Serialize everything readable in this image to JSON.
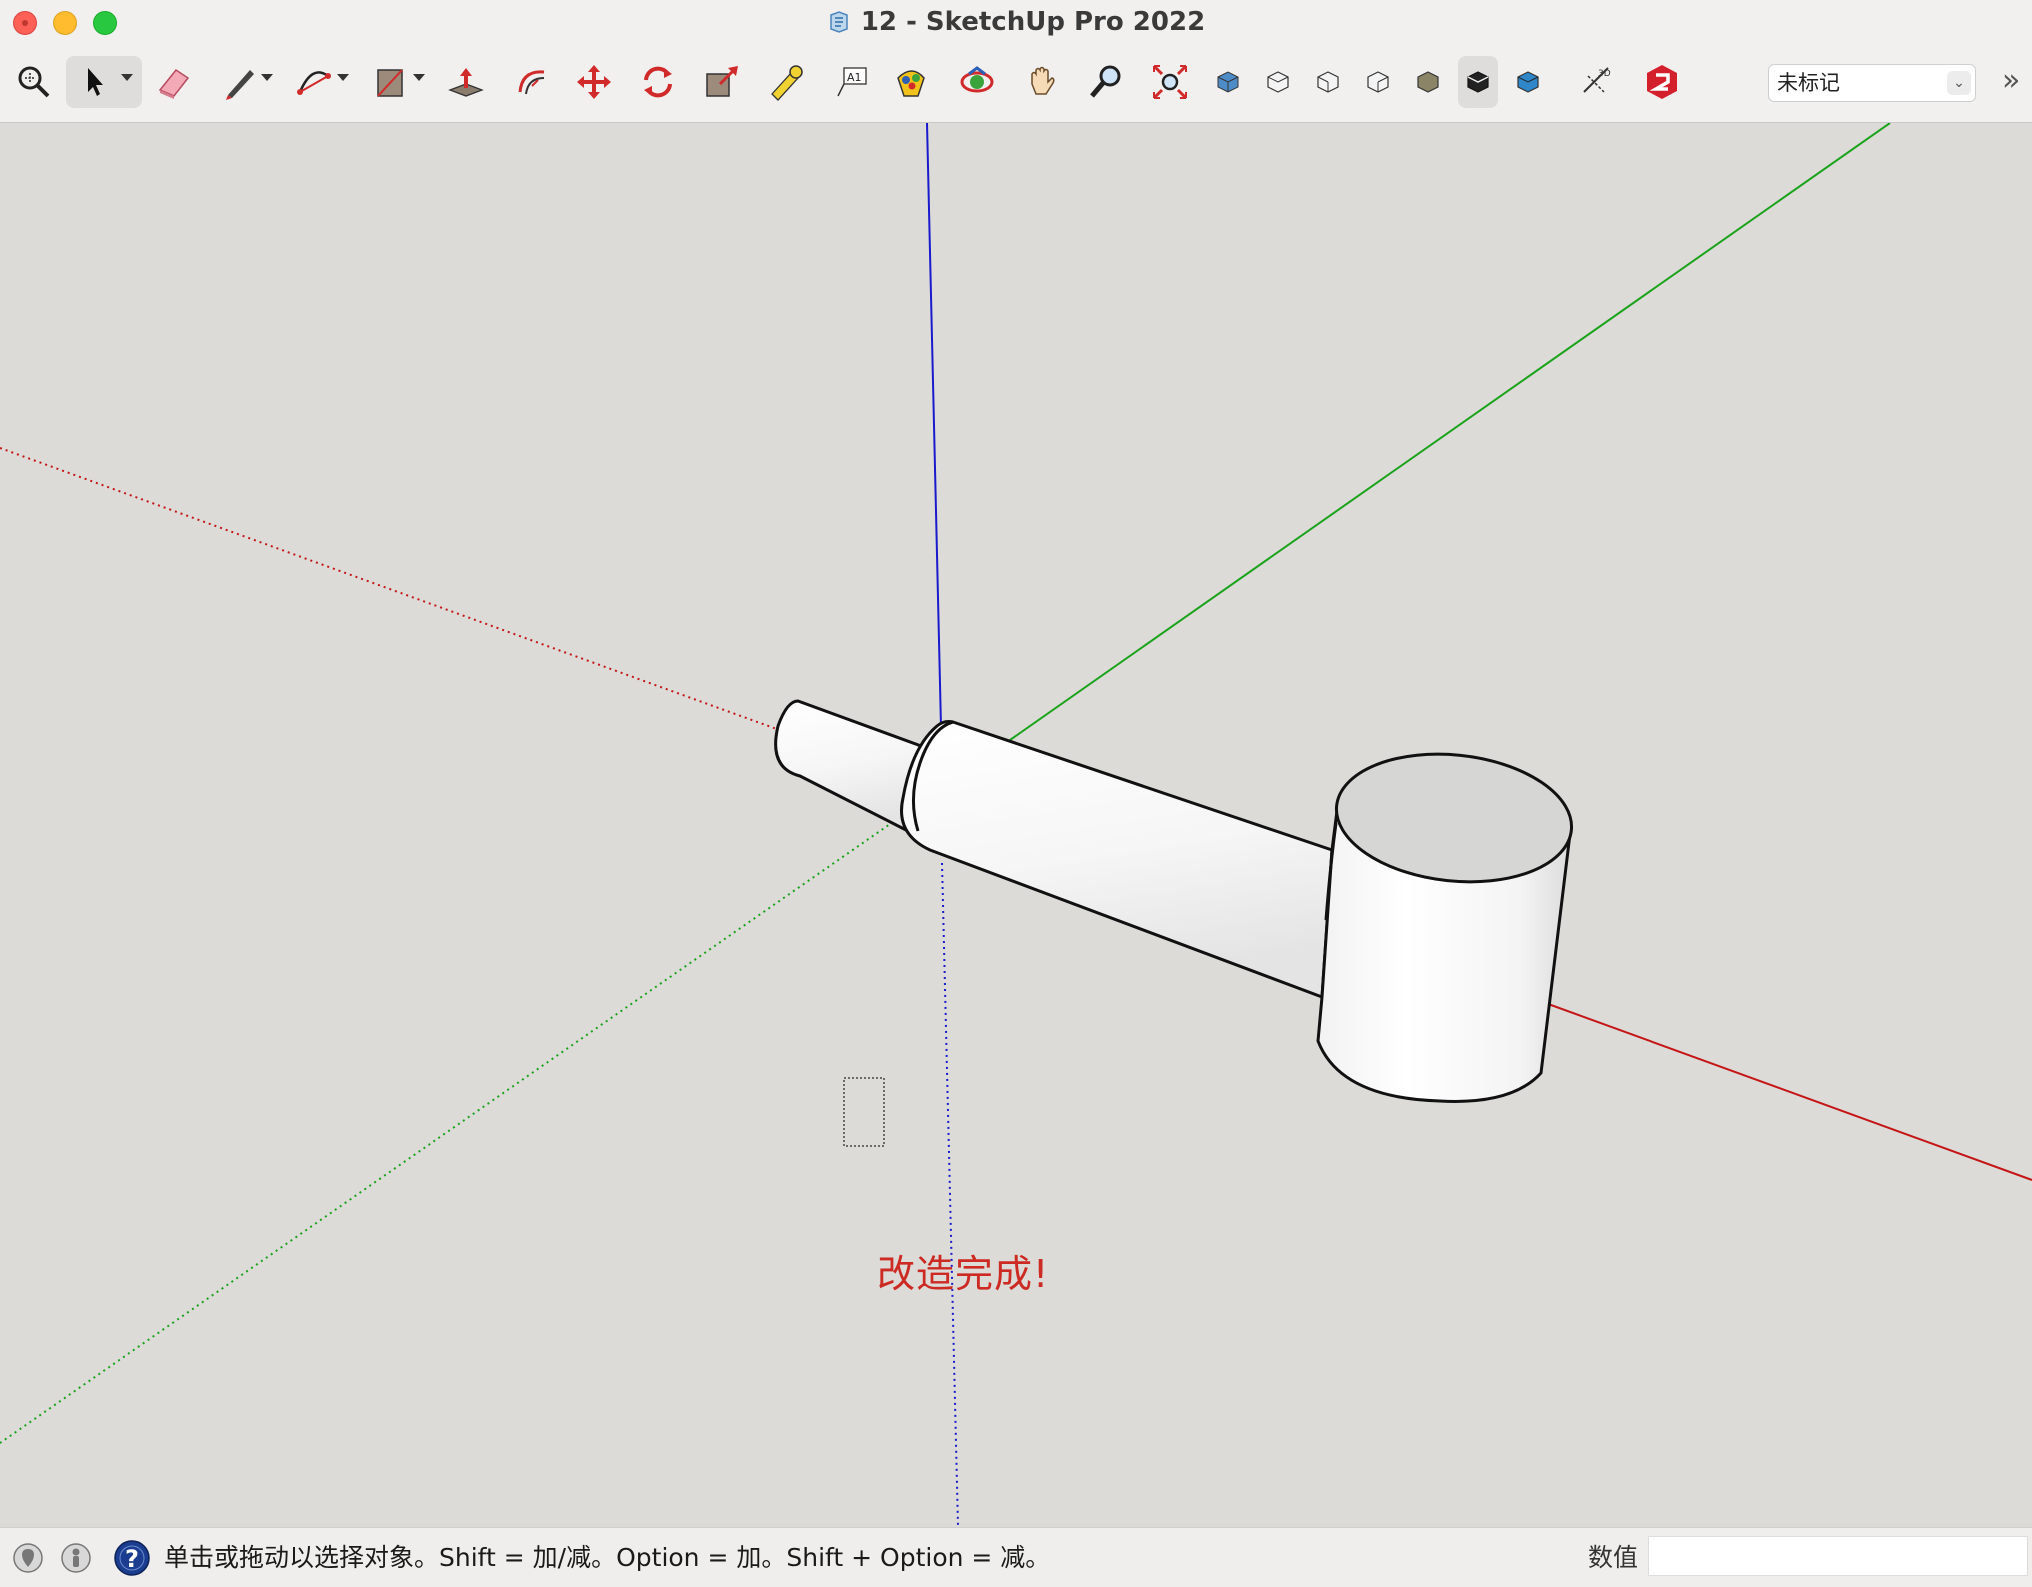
{
  "window": {
    "title": "12 - SketchUp Pro 2022"
  },
  "toolbar": {
    "tools": [
      "zoom-window",
      "select",
      "eraser",
      "line",
      "arc",
      "rectangle",
      "push-pull",
      "offset",
      "move",
      "rotate",
      "scale",
      "tape-measure",
      "text",
      "paint-bucket",
      "orbit",
      "pan",
      "zoom",
      "zoom-extents",
      "iso-view",
      "top-view",
      "front-view",
      "right-view",
      "back-view",
      "left-view",
      "section-plane",
      "3d-warehouse",
      "extension-warehouse"
    ],
    "active_tool": "select",
    "tag_select_value": "未标记"
  },
  "viewport": {
    "tooltip": "改造完成!",
    "axes": {
      "red": "#c41616",
      "green": "#1aa31a",
      "blue": "#1a1acc"
    },
    "background": "#dcdbd8"
  },
  "statusbar": {
    "message": "单击或拖动以选择对象。Shift = 加/减。Option = 加。Shift + Option = 减。",
    "measure_label": "数值",
    "measure_value": ""
  }
}
